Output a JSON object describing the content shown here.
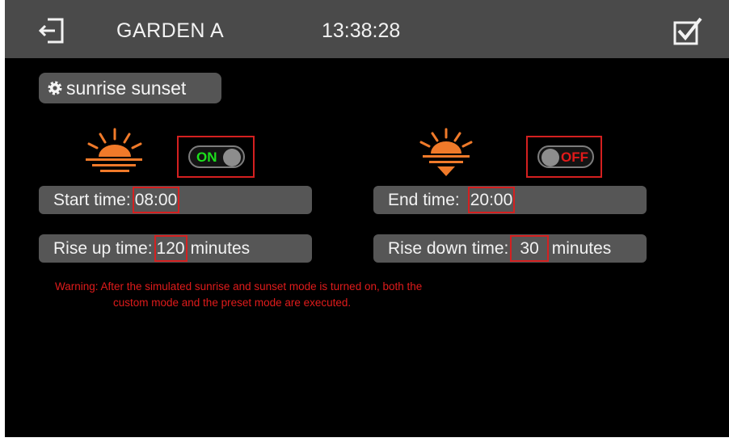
{
  "header": {
    "title": "GARDEN  A",
    "time": "13:38:28",
    "back_icon": "logout-arrow-icon",
    "confirm_icon": "checkbox-checked-icon"
  },
  "mode": {
    "title": "sunrise sunset",
    "icon": "gear-icon"
  },
  "sunrise": {
    "icon": "sunrise-icon",
    "toggle_label": "ON",
    "enabled": true,
    "start_label": "Start time:",
    "start_value": "08:00",
    "rise_label": "Rise up time:",
    "rise_value": "120",
    "rise_unit": "minutes"
  },
  "sunset": {
    "icon": "sunset-icon",
    "toggle_label": "OFF",
    "enabled": false,
    "end_label": "End time:",
    "end_value": "20:00",
    "down_label": "Rise down time:",
    "down_value": "30",
    "down_unit": "minutes"
  },
  "warning": {
    "line1": "Warning: After the simulated sunrise and sunset mode is turned on, both the",
    "line2": "custom mode and the preset mode are executed."
  },
  "colors": {
    "background": "#000000",
    "header_bg": "#4a4a4a",
    "field_bg": "#565656",
    "sun_orange": "#f07a2a",
    "on_green": "#1ce01c",
    "off_red": "#e21a1a",
    "highlight_red": "#d42020",
    "warning_red": "#e01b1b"
  }
}
